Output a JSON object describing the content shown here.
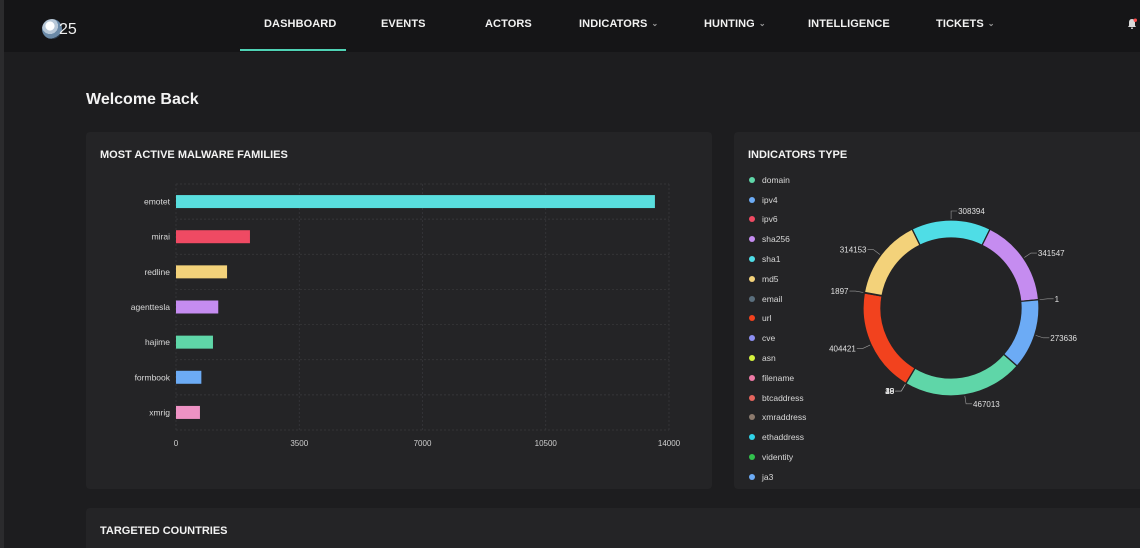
{
  "logo": {
    "text": "25"
  },
  "nav": {
    "items": [
      {
        "label": "DASHBOARD",
        "chevron": false
      },
      {
        "label": "EVENTS",
        "chevron": false
      },
      {
        "label": "ACTORS",
        "chevron": false
      },
      {
        "label": "INDICATORS",
        "chevron": true
      },
      {
        "label": "HUNTING",
        "chevron": true
      },
      {
        "label": "INTELLIGENCE",
        "chevron": false
      },
      {
        "label": "TICKETS",
        "chevron": true
      }
    ],
    "active": "DASHBOARD",
    "chevron_glyph": "⌄",
    "accent_color": "#4fd2b5",
    "notification_icon": "bell-icon"
  },
  "page": {
    "welcome": "Welcome Back"
  },
  "malware_card": {
    "title": "MOST ACTIVE MALWARE FAMILIES"
  },
  "indicators_card": {
    "title": "INDICATORS TYPE"
  },
  "countries_card": {
    "title": "TARGETED COUNTRIES"
  },
  "chart_data": [
    {
      "type": "bar",
      "orientation": "horizontal",
      "title": "MOST ACTIVE MALWARE FAMILIES",
      "categories": [
        "emotet",
        "mirai",
        "redline",
        "agenttesla",
        "hajime",
        "formbook",
        "xmrig"
      ],
      "values": [
        13600,
        2100,
        1450,
        1200,
        1050,
        720,
        680
      ],
      "colors": [
        "#59dede",
        "#ef4a63",
        "#f3d27a",
        "#c58cf0",
        "#5fd6a8",
        "#6cabf5",
        "#ee92c4"
      ],
      "xticks": [
        "0",
        "3500",
        "7000",
        "10500",
        "14000"
      ],
      "xlim": [
        0,
        14000
      ],
      "grid": true
    },
    {
      "type": "pie",
      "style": "donut",
      "title": "INDICATORS TYPE",
      "legend": [
        "domain",
        "ipv4",
        "ipv6",
        "sha256",
        "sha1",
        "md5",
        "email",
        "url",
        "cve",
        "asn",
        "filename",
        "btcaddress",
        "xmraddress",
        "ethaddress",
        "videntity",
        "ja3"
      ],
      "legend_colors": [
        "#5fd6a8",
        "#6cabf5",
        "#ef4a63",
        "#c58cf0",
        "#4fdde6",
        "#f3d27a",
        "#5b6f7d",
        "#f2421e",
        "#8d8ff2",
        "#d4f23e",
        "#ee7aa6",
        "#e5655e",
        "#8c7a6d",
        "#2fd3e8",
        "#32c24d",
        "#6cabf5"
      ],
      "legend_position": "left",
      "slices": [
        {
          "label": "domain",
          "value": 467013,
          "color": "#5fd6a8",
          "data_label": "467013"
        },
        {
          "label": "cve",
          "value": 40,
          "color": "#8d8ff2",
          "data_label": "40"
        },
        {
          "label": "asn",
          "value": 35,
          "color": "#d4f23e",
          "data_label": "35"
        },
        {
          "label": "email",
          "value": 29,
          "color": "#5b6f7d",
          "data_label": "29"
        },
        {
          "label": "filename",
          "value": 18,
          "color": "#ee7aa6",
          "data_label": "18"
        },
        {
          "label": "url",
          "value": 404421,
          "color": "#f2421e",
          "data_label": "404421"
        },
        {
          "label": "btcaddress",
          "value": 1897,
          "color": "#e5655e",
          "data_label": "1897"
        },
        {
          "label": "md5",
          "value": 314153,
          "color": "#f3d27a",
          "data_label": "314153"
        },
        {
          "label": "sha1",
          "value": 308394,
          "color": "#4fdde6",
          "data_label": "308394"
        },
        {
          "label": "sha256",
          "value": 341547,
          "color": "#c58cf0",
          "data_label": "341547"
        },
        {
          "label": "ipv6",
          "value": 1,
          "color": "#ef4a63",
          "data_label": "1"
        },
        {
          "label": "ipv4",
          "value": 273636,
          "color": "#6cabf5",
          "data_label": "273636"
        }
      ]
    }
  ]
}
